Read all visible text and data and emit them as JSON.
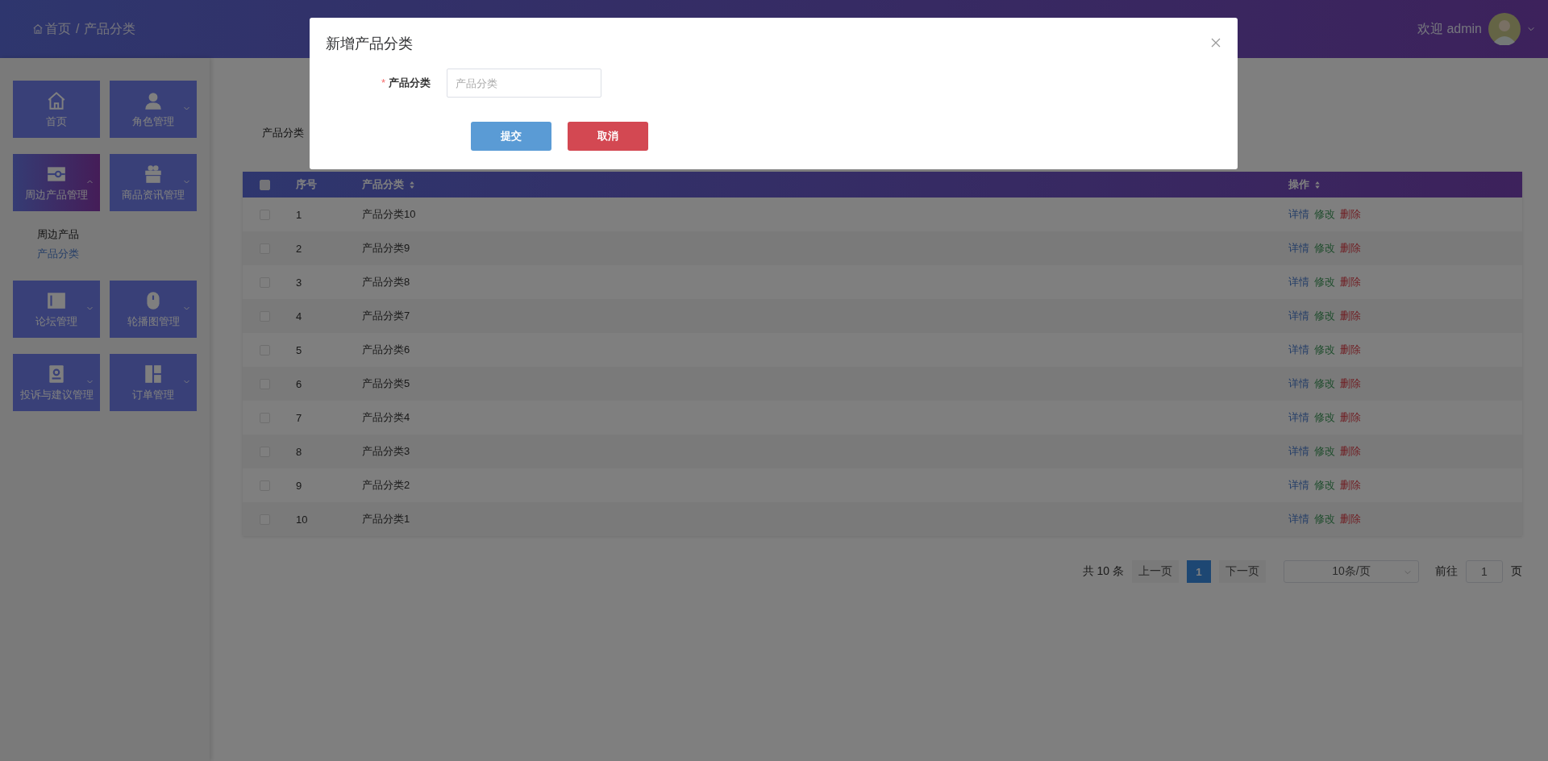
{
  "header": {
    "breadcrumb": [
      {
        "label": "首页",
        "kind": "home"
      },
      {
        "label": "产品分类",
        "kind": "page"
      }
    ],
    "separator": "/",
    "welcome": "欢迎 admin"
  },
  "sidebar": {
    "tiles": [
      {
        "label": "首页",
        "kind": "link",
        "selected": false
      },
      {
        "label": "角色管理",
        "kind": "menu",
        "selected": false,
        "expanded": false
      },
      {
        "label": "周边产品管理",
        "kind": "menu",
        "selected": true,
        "expanded": true,
        "children": [
          {
            "label": "周边产品",
            "selected": false
          },
          {
            "label": "产品分类",
            "selected": true
          }
        ]
      },
      {
        "label": "商品资讯管理",
        "kind": "menu",
        "selected": false,
        "expanded": false
      },
      {
        "label": "论坛管理",
        "kind": "menu",
        "selected": false,
        "expanded": false
      },
      {
        "label": "轮播图管理",
        "kind": "menu",
        "selected": false,
        "expanded": false
      },
      {
        "label": "投诉与建议管理",
        "kind": "menu",
        "selected": false,
        "expanded": false
      },
      {
        "label": "订单管理",
        "kind": "menu",
        "selected": false,
        "expanded": false
      }
    ]
  },
  "search": {
    "label": "产品分类"
  },
  "table": {
    "all_checked": false,
    "columns": [
      {
        "label": "序号",
        "sortable": false
      },
      {
        "label": "产品分类",
        "sortable": true
      },
      {
        "label": "操作",
        "sortable": true
      }
    ],
    "rows": [
      {
        "index": "1",
        "name": "产品分类10",
        "checked": false,
        "actions": [
          {
            "label": "详情",
            "kind": "detail"
          },
          {
            "label": "修改",
            "kind": "edit"
          },
          {
            "label": "删除",
            "kind": "delete"
          }
        ]
      },
      {
        "index": "2",
        "name": "产品分类9",
        "checked": false,
        "actions": [
          {
            "label": "详情",
            "kind": "detail"
          },
          {
            "label": "修改",
            "kind": "edit"
          },
          {
            "label": "删除",
            "kind": "delete"
          }
        ]
      },
      {
        "index": "3",
        "name": "产品分类8",
        "checked": false,
        "actions": [
          {
            "label": "详情",
            "kind": "detail"
          },
          {
            "label": "修改",
            "kind": "edit"
          },
          {
            "label": "删除",
            "kind": "delete"
          }
        ]
      },
      {
        "index": "4",
        "name": "产品分类7",
        "checked": false,
        "actions": [
          {
            "label": "详情",
            "kind": "detail"
          },
          {
            "label": "修改",
            "kind": "edit"
          },
          {
            "label": "删除",
            "kind": "delete"
          }
        ]
      },
      {
        "index": "5",
        "name": "产品分类6",
        "checked": false,
        "actions": [
          {
            "label": "详情",
            "kind": "detail"
          },
          {
            "label": "修改",
            "kind": "edit"
          },
          {
            "label": "删除",
            "kind": "delete"
          }
        ]
      },
      {
        "index": "6",
        "name": "产品分类5",
        "checked": false,
        "actions": [
          {
            "label": "详情",
            "kind": "detail"
          },
          {
            "label": "修改",
            "kind": "edit"
          },
          {
            "label": "删除",
            "kind": "delete"
          }
        ]
      },
      {
        "index": "7",
        "name": "产品分类4",
        "checked": false,
        "actions": [
          {
            "label": "详情",
            "kind": "detail"
          },
          {
            "label": "修改",
            "kind": "edit"
          },
          {
            "label": "删除",
            "kind": "delete"
          }
        ]
      },
      {
        "index": "8",
        "name": "产品分类3",
        "checked": false,
        "actions": [
          {
            "label": "详情",
            "kind": "detail"
          },
          {
            "label": "修改",
            "kind": "edit"
          },
          {
            "label": "删除",
            "kind": "delete"
          }
        ]
      },
      {
        "index": "9",
        "name": "产品分类2",
        "checked": false,
        "actions": [
          {
            "label": "详情",
            "kind": "detail"
          },
          {
            "label": "修改",
            "kind": "edit"
          },
          {
            "label": "删除",
            "kind": "delete"
          }
        ]
      },
      {
        "index": "10",
        "name": "产品分类1",
        "checked": false,
        "actions": [
          {
            "label": "详情",
            "kind": "detail"
          },
          {
            "label": "修改",
            "kind": "edit"
          },
          {
            "label": "删除",
            "kind": "delete"
          }
        ]
      }
    ]
  },
  "pagination": {
    "total": "共 10 条",
    "prev": "上一页",
    "pages": [
      {
        "label": "1",
        "selected": true
      }
    ],
    "next": "下一页",
    "page_size": "10条/页",
    "goto_label": "前往",
    "goto_value": "1",
    "goto_suffix": "页"
  },
  "modal": {
    "title": "新增产品分类",
    "fields": [
      {
        "label": "产品分类",
        "required": true,
        "required_mark": "*",
        "placeholder": "产品分类"
      }
    ],
    "buttons": [
      {
        "label": "提交",
        "kind": "primary"
      },
      {
        "label": "取消",
        "kind": "danger"
      }
    ]
  }
}
